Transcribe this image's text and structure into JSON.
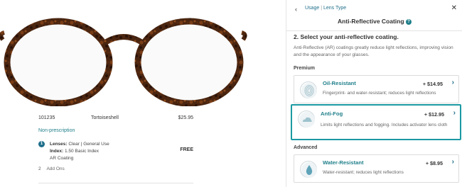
{
  "product": {
    "sku": "101235",
    "color": "Tortoiseshell",
    "price": "$25.95",
    "prescription": "Non-prescription",
    "step1": {
      "number": "1",
      "lenses_label": "Lenses:",
      "lenses_value": "Clear | General Use",
      "index_label": "Index:",
      "index_value": "1.50 Basic Index",
      "extra": "AR Coating",
      "price": "FREE"
    },
    "step2": {
      "number": "2",
      "label": "Add Ons"
    }
  },
  "panel": {
    "back_icon": "chevron-left-icon",
    "crumb_usage": "Usage",
    "crumb_sep": "|",
    "crumb_lens": "Lens Type",
    "close_icon": "close-icon",
    "title": "Anti-Reflective Coating",
    "help_glyph": "?",
    "section_title": "2. Select your anti-reflective coating.",
    "section_desc": "Anti-Reflective (AR) coatings greatly reduce light reflections, improving vision and the appearance of your glasses.",
    "group_premium": "Premium",
    "group_advanced": "Advanced",
    "options": [
      {
        "name": "Oil-Resistant",
        "price": "+ $14.95",
        "desc": "Fingerprint- and water-resistant; reduces light reflections",
        "icon": "fingerprint-icon"
      },
      {
        "name": "Anti-Fog",
        "price": "+ $12.95",
        "desc": "Limits light reflections and fogging. Includes activator lens cloth",
        "icon": "cloud-icon",
        "selected": true
      },
      {
        "name": "Water-Resistant",
        "price": "+ $8.95",
        "desc": "Water-resistant; reduces light reflections",
        "icon": "water-drop-icon"
      }
    ],
    "accent_color": "#1b9aa3",
    "link_color": "#1f6f8b"
  }
}
